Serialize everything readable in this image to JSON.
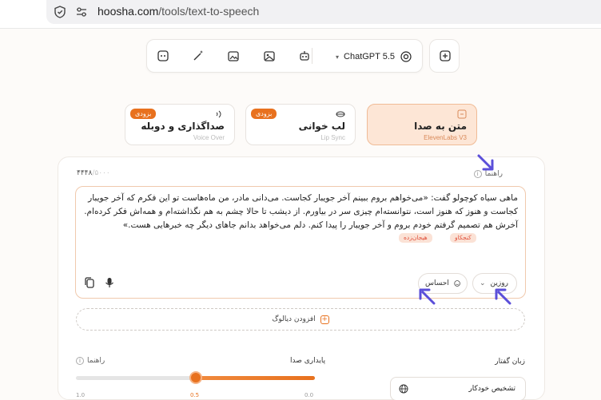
{
  "browser": {
    "url_host": "hoosha.com",
    "url_path": "/tools/text-to-speech"
  },
  "toolbar": {
    "model_name": "ChatGPT 5.5"
  },
  "modes": [
    {
      "title": "متن به صدا",
      "sub": "ElevenLabs V3",
      "badge": ""
    },
    {
      "title": "لب خوانی",
      "sub": "Lip Sync",
      "badge": "بزودی"
    },
    {
      "title": "صداگذاری و دوبله",
      "sub": "Voice Over",
      "badge": "بزودی"
    }
  ],
  "editor": {
    "counter_value": "۴۴۴۸",
    "counter_max": "/۵۰۰۰",
    "guide_label": "راهنما",
    "story": "ماهی سیاه کوچولو گفت: «می‌خواهم بروم ببینم آخر جویبار کجاست. می‌دانی مادر، من ماه‌هاست تو این فکرم که آخر جویبار کجاست و هنوز که هنوز است، نتوانسته‌ام چیزی سر در بیاورم. از دیشب تا حالا چشم به هم نگذاشته‌ام و همه‌اش فکر کرده‌ام. آخرش هم تصمیم گرفتم خودم بروم و آخر جویبار را پیدا کنم. دلم می‌خواهد بدانم جاهای دیگر چه خبرهایی هست.»",
    "tags": [
      "کنجکاو",
      "هیجان‌زده"
    ],
    "mood_label": "روزین",
    "emotion_label": "احساس"
  },
  "add_dialog_label": "افزودن دیالوگ",
  "controls": {
    "stability_label": "پایداری صدا",
    "stability_guide": "راهنما",
    "stability_value": 0.5,
    "ticks": [
      "1.0",
      "0.5",
      "0.0"
    ],
    "language_label": "زبان گفتار",
    "language_value": "تشخیص خودکار"
  },
  "colors": {
    "accent": "#e8711e",
    "annotation": "#5b4fd9"
  }
}
